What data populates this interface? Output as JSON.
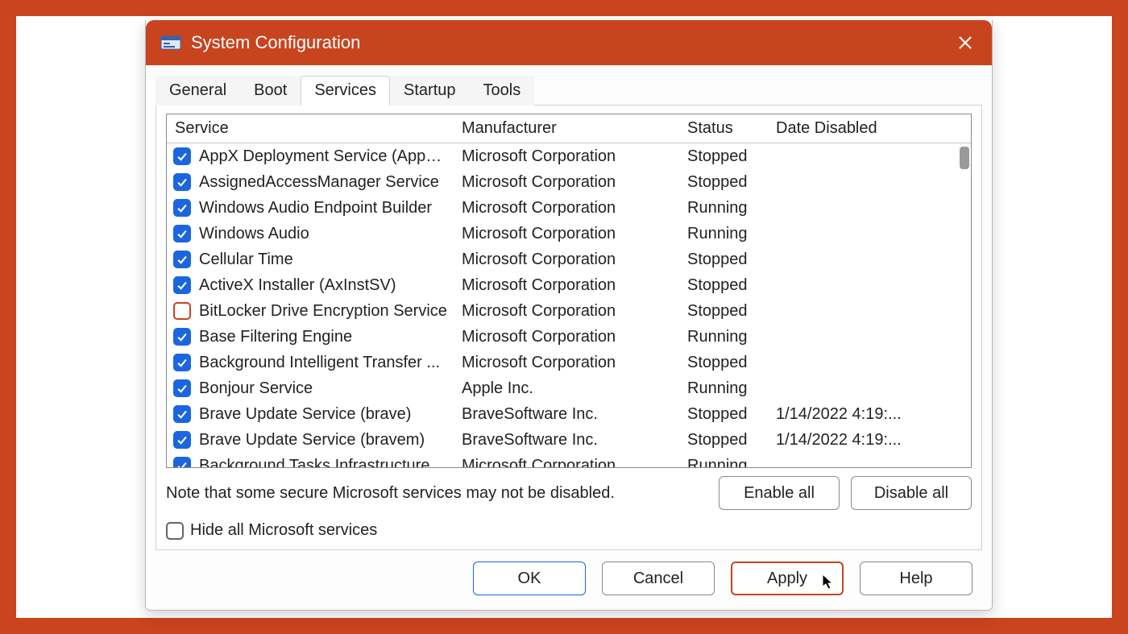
{
  "window": {
    "title": "System Configuration"
  },
  "tabs": [
    {
      "label": "General",
      "active": false
    },
    {
      "label": "Boot",
      "active": false
    },
    {
      "label": "Services",
      "active": true
    },
    {
      "label": "Startup",
      "active": false
    },
    {
      "label": "Tools",
      "active": false
    }
  ],
  "columns": {
    "service": "Service",
    "manufacturer": "Manufacturer",
    "status": "Status",
    "date_disabled": "Date Disabled"
  },
  "services": [
    {
      "checked": true,
      "name": "AppX Deployment Service (AppX...",
      "manufacturer": "Microsoft Corporation",
      "status": "Stopped",
      "date_disabled": ""
    },
    {
      "checked": true,
      "name": "AssignedAccessManager Service",
      "manufacturer": "Microsoft Corporation",
      "status": "Stopped",
      "date_disabled": ""
    },
    {
      "checked": true,
      "name": "Windows Audio Endpoint Builder",
      "manufacturer": "Microsoft Corporation",
      "status": "Running",
      "date_disabled": ""
    },
    {
      "checked": true,
      "name": "Windows Audio",
      "manufacturer": "Microsoft Corporation",
      "status": "Running",
      "date_disabled": ""
    },
    {
      "checked": true,
      "name": "Cellular Time",
      "manufacturer": "Microsoft Corporation",
      "status": "Stopped",
      "date_disabled": ""
    },
    {
      "checked": true,
      "name": "ActiveX Installer (AxInstSV)",
      "manufacturer": "Microsoft Corporation",
      "status": "Stopped",
      "date_disabled": ""
    },
    {
      "checked": false,
      "name": "BitLocker Drive Encryption Service",
      "manufacturer": "Microsoft Corporation",
      "status": "Stopped",
      "date_disabled": ""
    },
    {
      "checked": true,
      "name": "Base Filtering Engine",
      "manufacturer": "Microsoft Corporation",
      "status": "Running",
      "date_disabled": ""
    },
    {
      "checked": true,
      "name": "Background Intelligent Transfer ...",
      "manufacturer": "Microsoft Corporation",
      "status": "Stopped",
      "date_disabled": ""
    },
    {
      "checked": true,
      "name": "Bonjour Service",
      "manufacturer": "Apple Inc.",
      "status": "Running",
      "date_disabled": ""
    },
    {
      "checked": true,
      "name": "Brave Update Service (brave)",
      "manufacturer": "BraveSoftware Inc.",
      "status": "Stopped",
      "date_disabled": "1/14/2022 4:19:..."
    },
    {
      "checked": true,
      "name": "Brave Update Service (bravem)",
      "manufacturer": "BraveSoftware Inc.",
      "status": "Stopped",
      "date_disabled": "1/14/2022 4:19:..."
    },
    {
      "checked": true,
      "name": "Background Tasks Infrastructure",
      "manufacturer": "Microsoft Corporation",
      "status": "Running",
      "date_disabled": "",
      "partial": true
    }
  ],
  "note": "Note that some secure Microsoft services may not be disabled.",
  "hide_label": "Hide all Microsoft services",
  "buttons": {
    "enable_all": "Enable all",
    "disable_all": "Disable all",
    "ok": "OK",
    "cancel": "Cancel",
    "apply": "Apply",
    "help": "Help"
  }
}
